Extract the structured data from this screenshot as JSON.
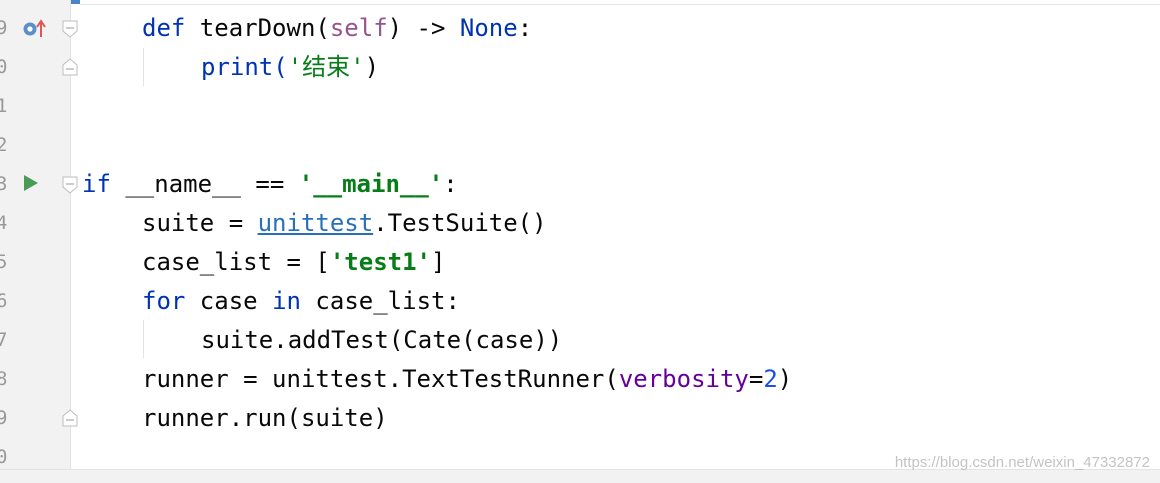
{
  "gutter": {
    "line_fragments": [
      "9",
      "0",
      "1",
      "2",
      "3",
      "4",
      "5",
      "6",
      "7",
      "8",
      "9",
      "0"
    ]
  },
  "code": {
    "line1": {
      "kw_def": "def",
      "name": " tearDown(",
      "self": "self",
      "tail": ") -> ",
      "none": "None",
      "colon": ":"
    },
    "line2": {
      "fn": "print(",
      "str": "'结束'",
      "close": ")"
    },
    "line5": {
      "kw_if": "if",
      "name": " __name__ == ",
      "str": "'__main__'",
      "colon": ":"
    },
    "line6": {
      "pre": "suite = ",
      "link": "unittest",
      "post": ".TestSuite()"
    },
    "line7": {
      "pre": "case_list = [",
      "str": "'test1'",
      "post": "]"
    },
    "line8": {
      "kw_for": "for",
      "mid": " case ",
      "kw_in": "in",
      "post": " case_list:"
    },
    "line9": {
      "text": "suite.addTest(Cate(case))"
    },
    "line10": {
      "pre": "runner = unittest.TextTestRunner(",
      "param": "verbosity",
      "eq": "=",
      "num": "2",
      "close": ")"
    },
    "line11": {
      "text": "runner.run(suite)"
    }
  },
  "icons": {
    "line1": "override-breakpoint-icon",
    "line5": "run-icon"
  },
  "colors": {
    "keyword": "#0033b3",
    "self": "#94558d",
    "string": "#067d17",
    "number": "#1750eb",
    "param": "#660099",
    "run_icon": "#499c54",
    "override_arrow": "#e05555"
  },
  "watermark": "https://blog.csdn.net/weixin_47332872"
}
